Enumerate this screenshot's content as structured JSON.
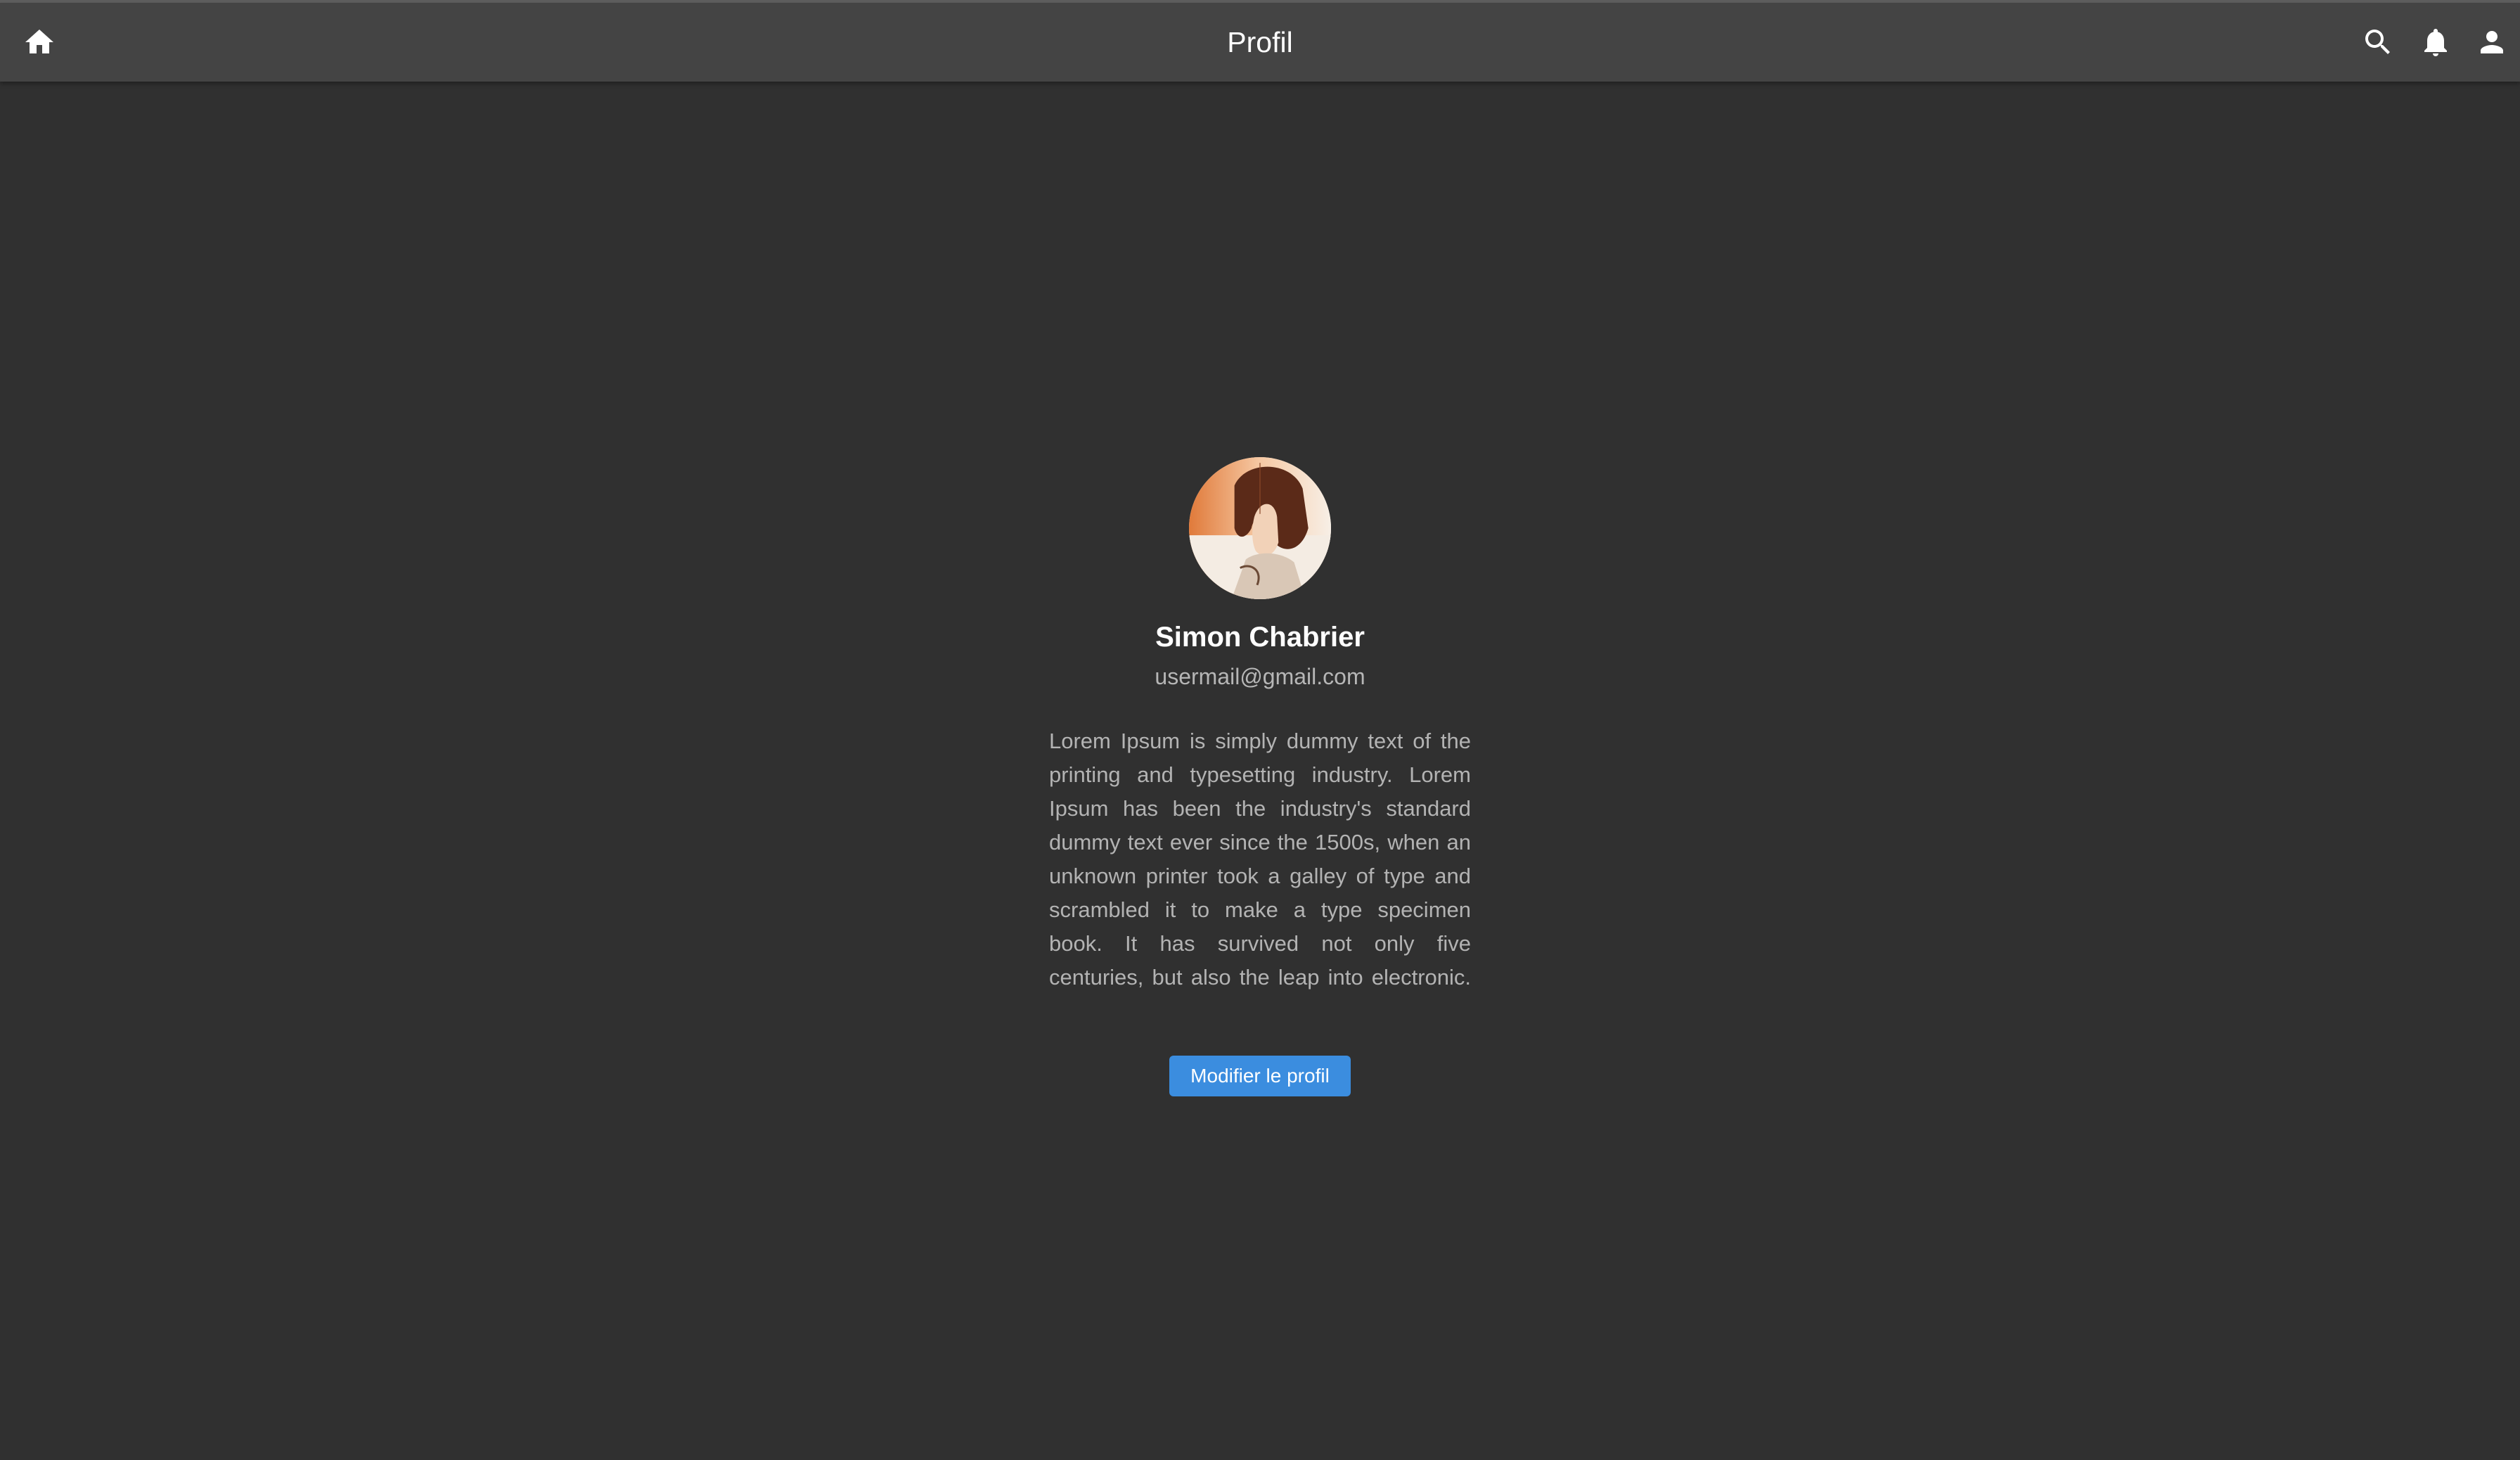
{
  "appbar": {
    "title": "Profil",
    "icons": {
      "home": "home-icon",
      "search": "search-icon",
      "notifications": "bell-icon",
      "account": "person-icon"
    }
  },
  "profile": {
    "name": "Simon Chabrier",
    "email": "usermail@gmail.com",
    "bio": "Lorem Ipsum is simply dummy text of the printing and typesetting industry. Lorem Ipsum has been the industry's standard dummy text ever since the 1500s, when an unknown printer took a galley of type and scrambled it to make a type specimen book. It has survived not only five centuries, but also the leap into electronic.",
    "edit_button_label": "Modifier le profil"
  },
  "colors": {
    "background": "#303030",
    "appbar": "#444444",
    "accent": "#3b8ddf"
  }
}
